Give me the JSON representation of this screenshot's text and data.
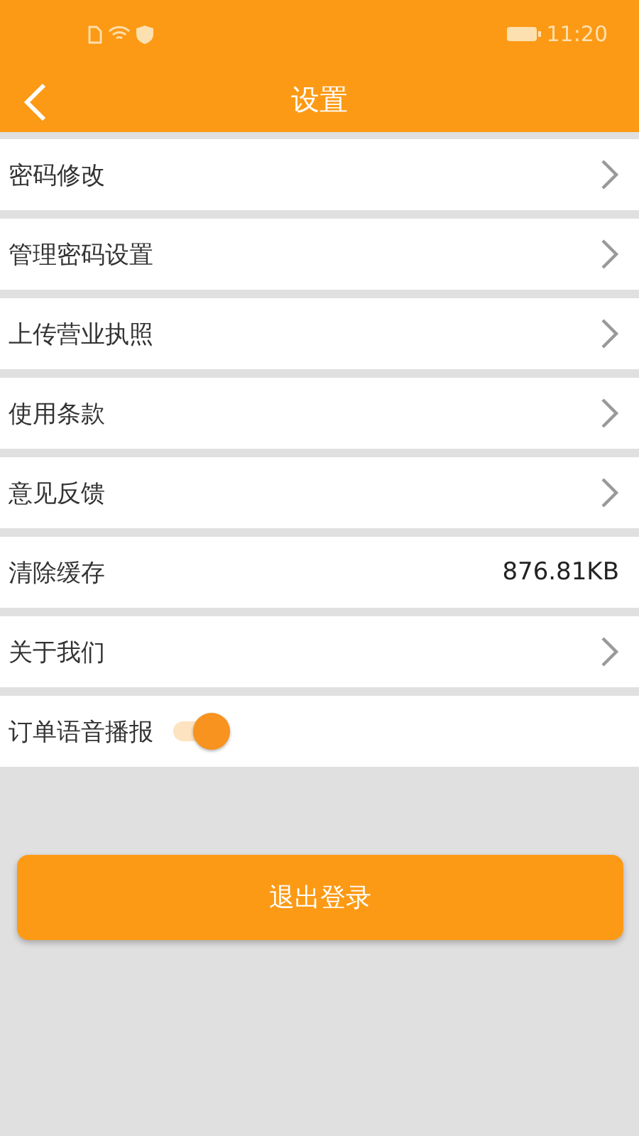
{
  "status_bar": {
    "time": "11:20"
  },
  "header": {
    "title": "设置"
  },
  "items": [
    {
      "kind": "link",
      "label": "密码修改"
    },
    {
      "kind": "link",
      "label": "管理密码设置"
    },
    {
      "kind": "link",
      "label": "上传营业执照"
    },
    {
      "kind": "link",
      "label": "使用条款"
    },
    {
      "kind": "link",
      "label": "意见反馈"
    },
    {
      "kind": "value",
      "label": "清除缓存",
      "value": "876.81KB"
    },
    {
      "kind": "link",
      "label": "关于我们"
    },
    {
      "kind": "toggle",
      "label": "订单语音播报",
      "on": true
    }
  ],
  "logout_button": {
    "label": "退出登录"
  }
}
